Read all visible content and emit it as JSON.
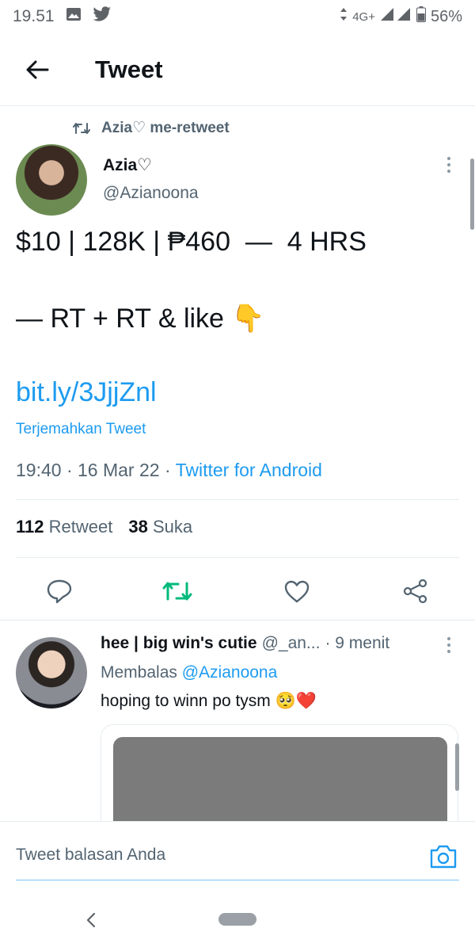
{
  "status_bar": {
    "time": "19.51",
    "network": "4G+",
    "battery": "56%",
    "icons": [
      "gallery-icon",
      "twitter-bird-icon",
      "signal-icon",
      "battery-icon"
    ]
  },
  "header": {
    "title": "Tweet",
    "back_icon": "arrow-left-icon"
  },
  "tweet": {
    "retweet_context": "Azia♡ me-retweet",
    "author_name": "Azia♡",
    "author_handle": "@Azianoona",
    "line1": "$10 | 128K | ₱460  —  4 HRS",
    "line2": "— RT + RT & like 👇",
    "link": "bit.ly/3JjjZnl",
    "translate": "Terjemahkan Tweet",
    "timestamp": "19:40 · 16 Mar 22 · ",
    "source": "Twitter for Android",
    "retweet_count": "112",
    "retweet_label": "Retweet",
    "like_count": "38",
    "like_label": "Suka"
  },
  "actions": {
    "icons": [
      "reply-icon",
      "retweet-icon",
      "like-icon",
      "share-icon"
    ],
    "retweet_active_color": "#00ba7c"
  },
  "reply": {
    "name": "hee | big win's cutie",
    "handle": "@_an...",
    "time": "· 9 menit",
    "replying_prefix": "Membalas",
    "replying_mention": "@Azianoona",
    "text": "hoping to winn po tysm 🥺❤️"
  },
  "compose": {
    "placeholder": "Tweet balasan Anda"
  },
  "colors": {
    "accent": "#1d9bf0",
    "muted": "#536471",
    "text": "#0f1419"
  }
}
